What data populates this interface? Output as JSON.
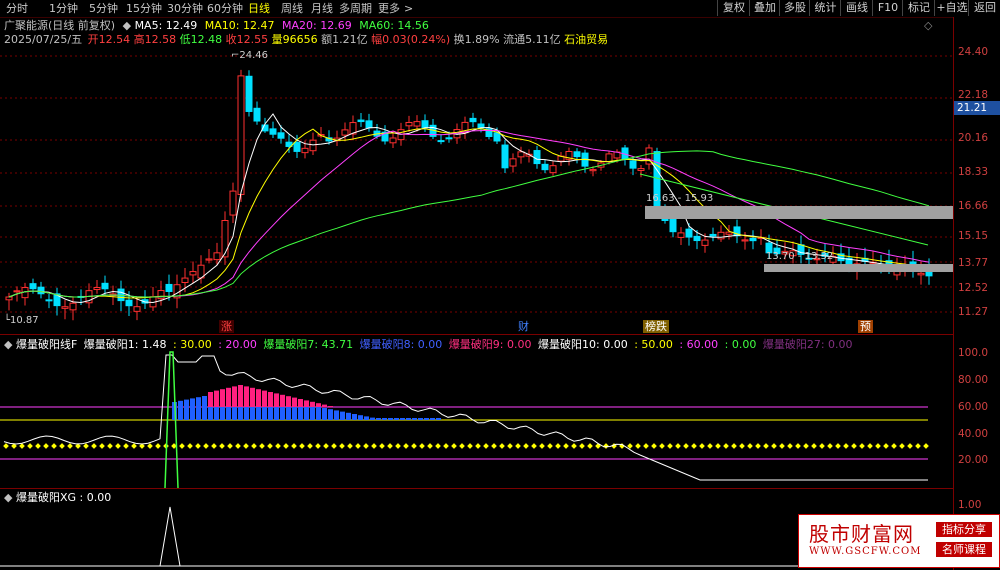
{
  "toolbar": {
    "tabs": [
      "分时",
      "1分钟",
      "5分钟",
      "15分钟",
      "30分钟",
      "60分钟",
      "日线",
      "周线",
      "月线",
      "多周期",
      "更多"
    ],
    "active_tab": "日线",
    "right_buttons": [
      "复权",
      "叠加",
      "多股",
      "统计",
      "画线",
      "F10",
      "标记",
      "+自选",
      "返回"
    ],
    "more_arrow": ">"
  },
  "stock": {
    "name": "广聚能源(日线 前复权)",
    "ma": [
      {
        "label": "MA5: 12.49",
        "color": "#ffffff"
      },
      {
        "label": "MA10: 12.47",
        "color": "#ffff00"
      },
      {
        "label": "MA20: 12.69",
        "color": "#ff40ff"
      },
      {
        "label": "MA60: 14.56",
        "color": "#40ff40"
      }
    ],
    "date": "2025/07/25/五",
    "open": "开12.54",
    "high": "高12.58",
    "low": "低12.48",
    "close": "收12.55",
    "volume": "量96656",
    "amount": "额1.21亿",
    "change": "幅0.03(0.24%)",
    "turnover": "换1.89%",
    "float_cap": "流通5.11亿",
    "industry": "石油贸易"
  },
  "price_axis": {
    "labels": [
      "24.40",
      "22.18",
      "20.16",
      "18.33",
      "16.66",
      "15.15",
      "13.77",
      "12.52",
      "11.27"
    ],
    "current": "21.21"
  },
  "annotations": {
    "high": "24.46",
    "low": "10.87",
    "zone1": "16.63 - 15.93",
    "zone2": "13.70 - 13.32"
  },
  "events": [
    {
      "label": "涨",
      "color": "#ff4040",
      "bg": "#400000"
    },
    {
      "label": "财",
      "color": "#4080ff",
      "bg": "#000000"
    },
    {
      "label": "榜跌",
      "color": "#ffffff",
      "bg": "#806000"
    },
    {
      "label": "预",
      "color": "#ffffff",
      "bg": "#a04000"
    }
  ],
  "indicator1": {
    "title": "爆量破阳线F",
    "items": [
      {
        "text": "爆量破阳1: 1.48",
        "color": "#ffffff"
      },
      {
        "text": ": 30.00",
        "color": "#ffff00"
      },
      {
        "text": ": 20.00",
        "color": "#ff40ff"
      },
      {
        "text": "爆量破阳7: 43.71",
        "color": "#40ff40"
      },
      {
        "text": "爆量破阳8: 0.00",
        "color": "#4060ff"
      },
      {
        "text": "爆量破阳9: 0.00",
        "color": "#ff3080"
      },
      {
        "text": "爆量破阳10: 0.00",
        "color": "#ffffff"
      },
      {
        "text": ": 50.00",
        "color": "#ffff00"
      },
      {
        "text": ": 60.00",
        "color": "#ff40ff"
      },
      {
        "text": ": 0.00",
        "color": "#40ff40"
      },
      {
        "text": "爆量破阳27: 0.00",
        "color": "#803080"
      }
    ],
    "axis": [
      "100.0",
      "80.00",
      "60.00",
      "40.00",
      "20.00"
    ]
  },
  "indicator2": {
    "title": "爆量破阳XG",
    "value": ": 0.00",
    "axis": [
      "1.00"
    ]
  },
  "watermark": {
    "title": "股市财富网",
    "url": "WWW.GSCFW.COM",
    "tag1": "指标分享",
    "tag2": "名师课程"
  },
  "colors": {
    "up": "#ff3030",
    "down": "#00e0ff",
    "ma5": "#ffffff",
    "ma10": "#ffff00",
    "ma20": "#ff40ff",
    "ma60": "#40ff40",
    "grid": "#7a0000"
  }
}
